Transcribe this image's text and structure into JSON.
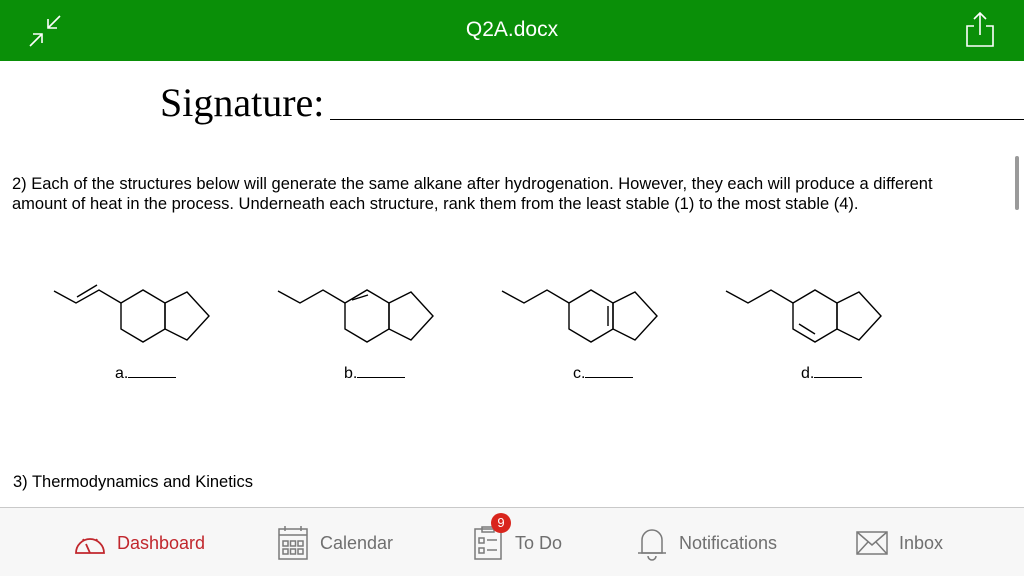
{
  "header": {
    "title": "Q2A.docx",
    "background": "#0a8f08",
    "left_icon": "collapse-icon",
    "right_icon": "share-icon"
  },
  "document": {
    "signature_label": "Signature:",
    "question2_text": "2) Each of the structures below will generate the same alkane after hydrogenation. However, they each will produce a different amount of heat in the process. Underneath each structure, rank them from the least stable (1) to the most stable (4).",
    "answers": [
      "a.",
      "b.",
      "c.",
      "d."
    ],
    "question3_text": "3) Thermodynamics and Kinetics"
  },
  "tabbar": {
    "active_color": "#c1272d",
    "items": [
      {
        "label": "Dashboard",
        "icon": "dashboard-icon"
      },
      {
        "label": "Calendar",
        "icon": "calendar-icon"
      },
      {
        "label": "To Do",
        "icon": "todo-icon",
        "badge": "9"
      },
      {
        "label": "Notifications",
        "icon": "bell-icon"
      },
      {
        "label": "Inbox",
        "icon": "inbox-icon"
      }
    ]
  }
}
